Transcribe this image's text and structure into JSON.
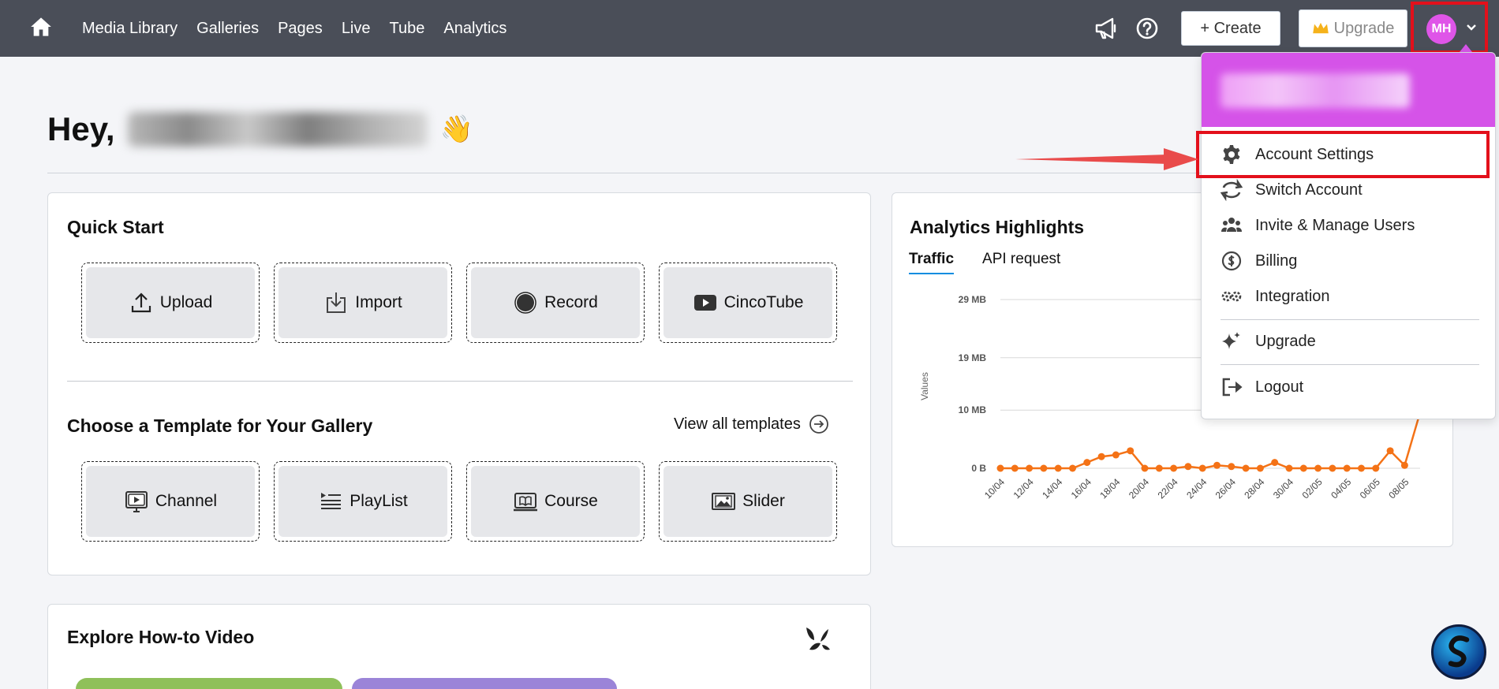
{
  "nav": {
    "items": [
      "Media Library",
      "Galleries",
      "Pages",
      "Live",
      "Tube",
      "Analytics"
    ],
    "create_label": "+ Create",
    "upgrade_label": "Upgrade",
    "avatar_initials": "MH"
  },
  "greeting": {
    "prefix": "Hey,",
    "wave": "👋"
  },
  "quick_start": {
    "title": "Quick Start",
    "tiles": [
      {
        "label": "Upload",
        "icon": "upload-icon"
      },
      {
        "label": "Import",
        "icon": "import-icon"
      },
      {
        "label": "Record",
        "icon": "record-icon"
      },
      {
        "label": "CincoTube",
        "icon": "youtube-icon"
      }
    ]
  },
  "templates": {
    "title": "Choose a Template for Your Gallery",
    "view_all_label": "View all templates",
    "tiles": [
      {
        "label": "Channel",
        "icon": "channel-icon"
      },
      {
        "label": "PlayList",
        "icon": "playlist-icon"
      },
      {
        "label": "Course",
        "icon": "course-icon"
      },
      {
        "label": "Slider",
        "icon": "slider-icon"
      }
    ]
  },
  "analytics": {
    "title": "Analytics Highlights",
    "tabs": [
      "Traffic",
      "API request"
    ],
    "active_tab": "Traffic"
  },
  "explore": {
    "title": "Explore How-to Video"
  },
  "dropdown": {
    "items": [
      {
        "label": "Account Settings",
        "icon": "gear-icon"
      },
      {
        "label": "Switch Account",
        "icon": "switch-icon"
      },
      {
        "label": "Invite & Manage Users",
        "icon": "users-icon"
      },
      {
        "label": "Billing",
        "icon": "billing-icon"
      },
      {
        "label": "Integration",
        "icon": "integration-icon"
      },
      {
        "label": "Upgrade",
        "icon": "sparkle-icon"
      },
      {
        "label": "Logout",
        "icon": "logout-icon"
      }
    ]
  },
  "colors": {
    "topbar": "#4a4e58",
    "accent": "#d553e8",
    "series": "#f47216",
    "highlight": "#e3101b"
  },
  "chart_data": {
    "type": "line",
    "ylabel": "Values",
    "yticks": [
      "0 B",
      "10 MB",
      "19 MB",
      "29 MB"
    ],
    "ylim": [
      0,
      29
    ],
    "x": [
      "10/04",
      "11/04",
      "12/04",
      "13/04",
      "14/04",
      "15/04",
      "16/04",
      "17/04",
      "18/04",
      "19/04",
      "20/04",
      "21/04",
      "22/04",
      "23/04",
      "24/04",
      "25/04",
      "26/04",
      "27/04",
      "28/04",
      "29/04",
      "30/04",
      "01/05",
      "02/05",
      "03/05",
      "04/05",
      "05/05",
      "06/05",
      "07/05",
      "08/05",
      "09/05"
    ],
    "xtick_labels": [
      "10/04",
      "12/04",
      "14/04",
      "16/04",
      "18/04",
      "20/04",
      "22/04",
      "24/04",
      "26/04",
      "28/04",
      "30/04",
      "02/05",
      "04/05",
      "06/05",
      "08/05"
    ],
    "series": [
      {
        "values": [
          0,
          0,
          0,
          0,
          0,
          0,
          1,
          2,
          2.3,
          3,
          0,
          0,
          0,
          0.3,
          0,
          0.5,
          0.3,
          0,
          0,
          1,
          0,
          0,
          0,
          0,
          0,
          0,
          0,
          3,
          0.5,
          9
        ]
      }
    ],
    "grid": true
  }
}
